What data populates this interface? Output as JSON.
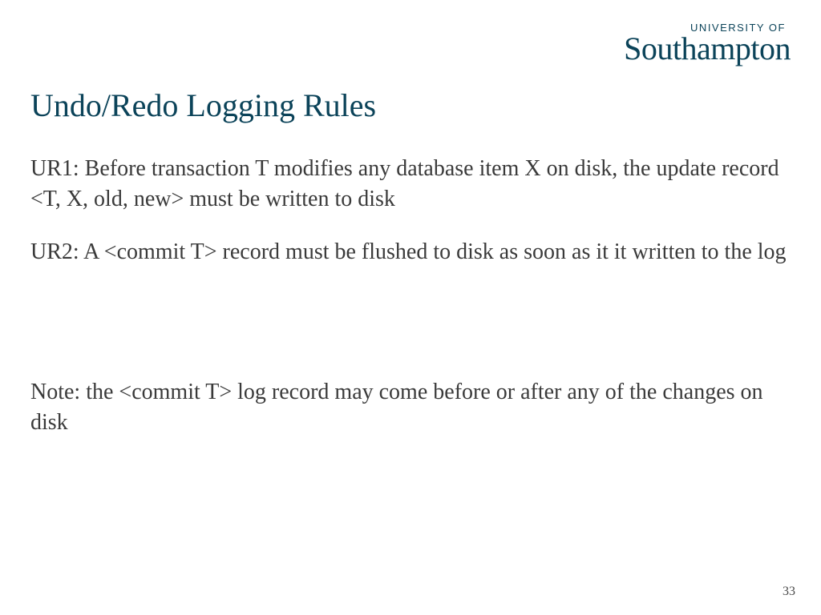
{
  "logo": {
    "top": "UNIVERSITY OF",
    "main": "Southampton"
  },
  "title": "Undo/Redo Logging Rules",
  "paragraphs": {
    "p1": "UR1: Before transaction T modifies any database item X on disk, the update record <T, X, old, new> must be written to disk",
    "p2": "UR2: A <commit T> record must be flushed to disk as soon as it it written to the log",
    "p3": "Note: the <commit T> log record may come before or after any of the changes on disk"
  },
  "page_number": "33"
}
